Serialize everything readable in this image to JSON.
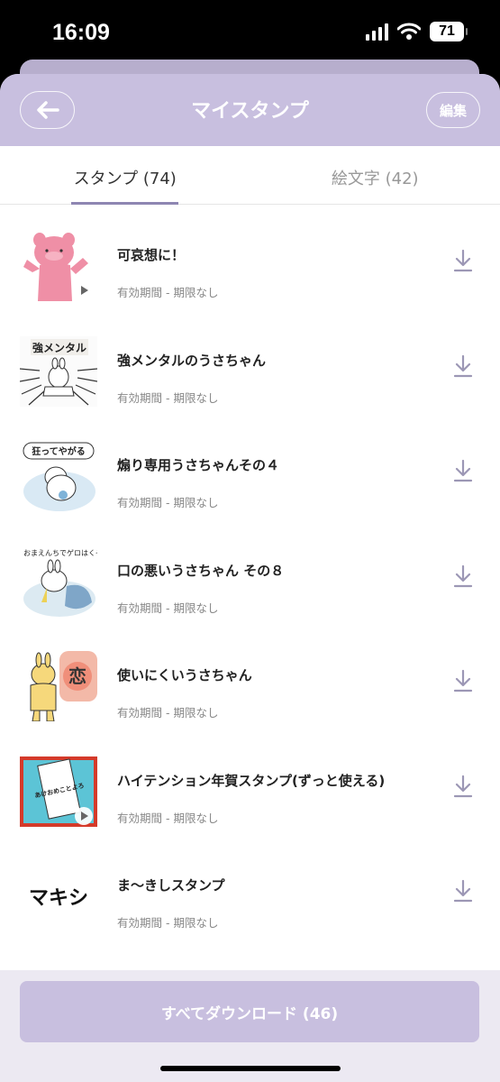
{
  "status_bar": {
    "time": "16:09",
    "battery": "71"
  },
  "header": {
    "title": "マイスタンプ",
    "edit_label": "編集"
  },
  "tabs": [
    {
      "label": "スタンプ (74)",
      "active": true
    },
    {
      "label": "絵文字 (42)",
      "active": false
    }
  ],
  "stickers": [
    {
      "name": "可哀想に！",
      "validity": "有効期間 - 期限なし",
      "thumb_text": ""
    },
    {
      "name": "強メンタルのうさちゃん",
      "validity": "有効期間 - 期限なし",
      "thumb_text": "強メンタル"
    },
    {
      "name": "煽り専用うさちゃんその４",
      "validity": "有効期間 - 期限なし",
      "thumb_text": "狂ってやがる"
    },
    {
      "name": "口の悪いうさちゃん その８",
      "validity": "有効期間 - 期限なし",
      "thumb_text": "おまえんちでゲロはくぞ"
    },
    {
      "name": "使いにくいうさちゃん",
      "validity": "有効期間 - 期限なし",
      "thumb_text": "恋"
    },
    {
      "name": "ハイテンション年賀スタンプ(ずっと使える)",
      "validity": "有効期間 - 期限なし",
      "thumb_text": "あけおめことよろ"
    },
    {
      "name": "ま〜きしスタンプ",
      "validity": "有効期間 - 期限なし",
      "thumb_text": "マキシ"
    }
  ],
  "footer": {
    "download_all_label": "すべてダウンロード (46)"
  },
  "icons": {
    "back": "arrow-left-icon",
    "download": "download-icon",
    "play": "play-icon",
    "wifi": "wifi-icon",
    "signal": "signal-icon",
    "battery": "battery-icon"
  },
  "colors": {
    "header": "#c8bfdf",
    "accent": "#8e86b2",
    "download_icon": "#9c97b5"
  }
}
